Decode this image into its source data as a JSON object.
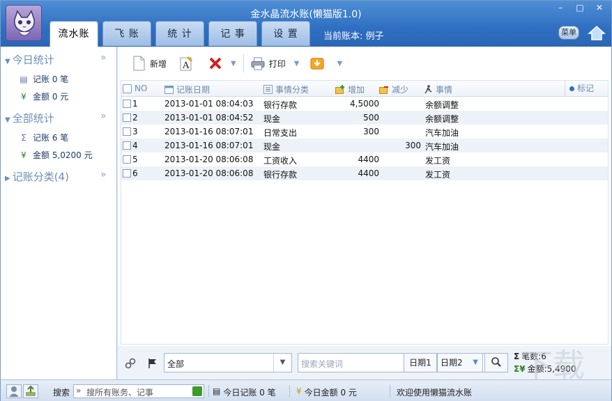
{
  "app": {
    "title": "金水晶流水账(懒猫版1.0)",
    "window_controls": {
      "minimize": "–",
      "maximize": "□",
      "close": "✕"
    }
  },
  "tabs": [
    {
      "label": "流水账",
      "active": true
    },
    {
      "label": "飞 账",
      "active": false
    },
    {
      "label": "统 计",
      "active": false
    },
    {
      "label": "记 事",
      "active": false
    },
    {
      "label": "设 置",
      "active": false
    }
  ],
  "current_account": "当前账本: 例子",
  "menu_button": "菜单",
  "left": {
    "today": {
      "title": "今日统计",
      "records": "记账 0 笔",
      "amount": "金额 0 元"
    },
    "all": {
      "title": "全部统计",
      "records": "记账 6 笔",
      "amount": "金额 5,0200 元"
    },
    "categories": {
      "title": "记账分类(4)"
    }
  },
  "toolbar": {
    "new": "新增",
    "print": "打印"
  },
  "table": {
    "headers": {
      "no": "NO",
      "date": "记账日期",
      "category": "事情分类",
      "increase": "增加",
      "decrease": "减少",
      "event": "事情",
      "mark": "标记"
    },
    "rows": [
      {
        "no": "1",
        "date": "2013-01-01 08:04:03",
        "category": "银行存款",
        "increase": "4,5000",
        "decrease": "",
        "event": "余额调整"
      },
      {
        "no": "2",
        "date": "2013-01-01 08:04:52",
        "category": "现金",
        "increase": "500",
        "decrease": "",
        "event": "余额调整"
      },
      {
        "no": "3",
        "date": "2013-01-16 08:07:01",
        "category": "日常支出",
        "increase": "300",
        "decrease": "",
        "event": "汽车加油"
      },
      {
        "no": "4",
        "date": "2013-01-16 08:07:01",
        "category": "现金",
        "increase": "",
        "decrease": "300",
        "event": "汽车加油"
      },
      {
        "no": "5",
        "date": "2013-01-20 08:06:08",
        "category": "工资收入",
        "increase": "4400",
        "decrease": "",
        "event": "发工资"
      },
      {
        "no": "6",
        "date": "2013-01-20 08:06:08",
        "category": "银行存款",
        "increase": "4400",
        "decrease": "",
        "event": "发工资"
      }
    ]
  },
  "filter": {
    "scope": "全部",
    "search_placeholder": "搜索关键词",
    "date1": "日期1",
    "date2": "日期2",
    "count": "笔数:6",
    "total": "金额:5,4900"
  },
  "status": {
    "search_label": "搜索",
    "search_placeholder": "搜所有账务、记事",
    "today_records": "今日记账 0 笔",
    "today_amount": "今日金额 0 元",
    "welcome": "欢迎使用懒猫流水账"
  },
  "watermark": "下载"
}
